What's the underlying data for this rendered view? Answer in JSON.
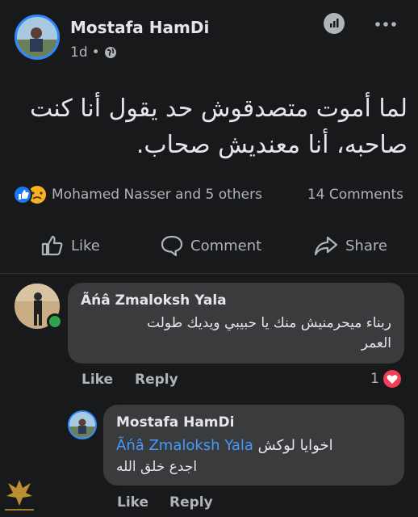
{
  "post": {
    "author": "Mostafa HamDi",
    "time": "1d",
    "separator": "•",
    "more_icon": "ellipsis-icon",
    "text_line1": "لما أموت متصدقوش حد يقول أنا كنت",
    "text_line2": "صاحبه، أنا معنديش صحاب.",
    "reactions_text": "Mohamed Nasser and 5 others",
    "comments_count": "14 Comments",
    "actions": {
      "like": "Like",
      "comment": "Comment",
      "share": "Share"
    }
  },
  "comments": [
    {
      "author": "Ãńâ Zmaloksh Yala",
      "text_line1": "ربناء ميحرمنيش منك يا حبيبي ويديك طولت",
      "text_line2": "العمر",
      "like": "Like",
      "reply": "Reply",
      "reaction_count": "1"
    }
  ],
  "reply": {
    "author": "Mostafa HamDi",
    "mention": "Ãńâ Zmaloksh Yala",
    "text_part": "اخوايا لوكش",
    "text_line2": "اجدع خلق الله",
    "like": "Like",
    "reply": "Reply"
  },
  "colors": {
    "background": "#18191a",
    "bubble": "#3a3b3c",
    "mention": "#4599ff",
    "like_blue": "#1877f2",
    "online_green": "#31a24c",
    "heart_red": "#f33e58"
  }
}
